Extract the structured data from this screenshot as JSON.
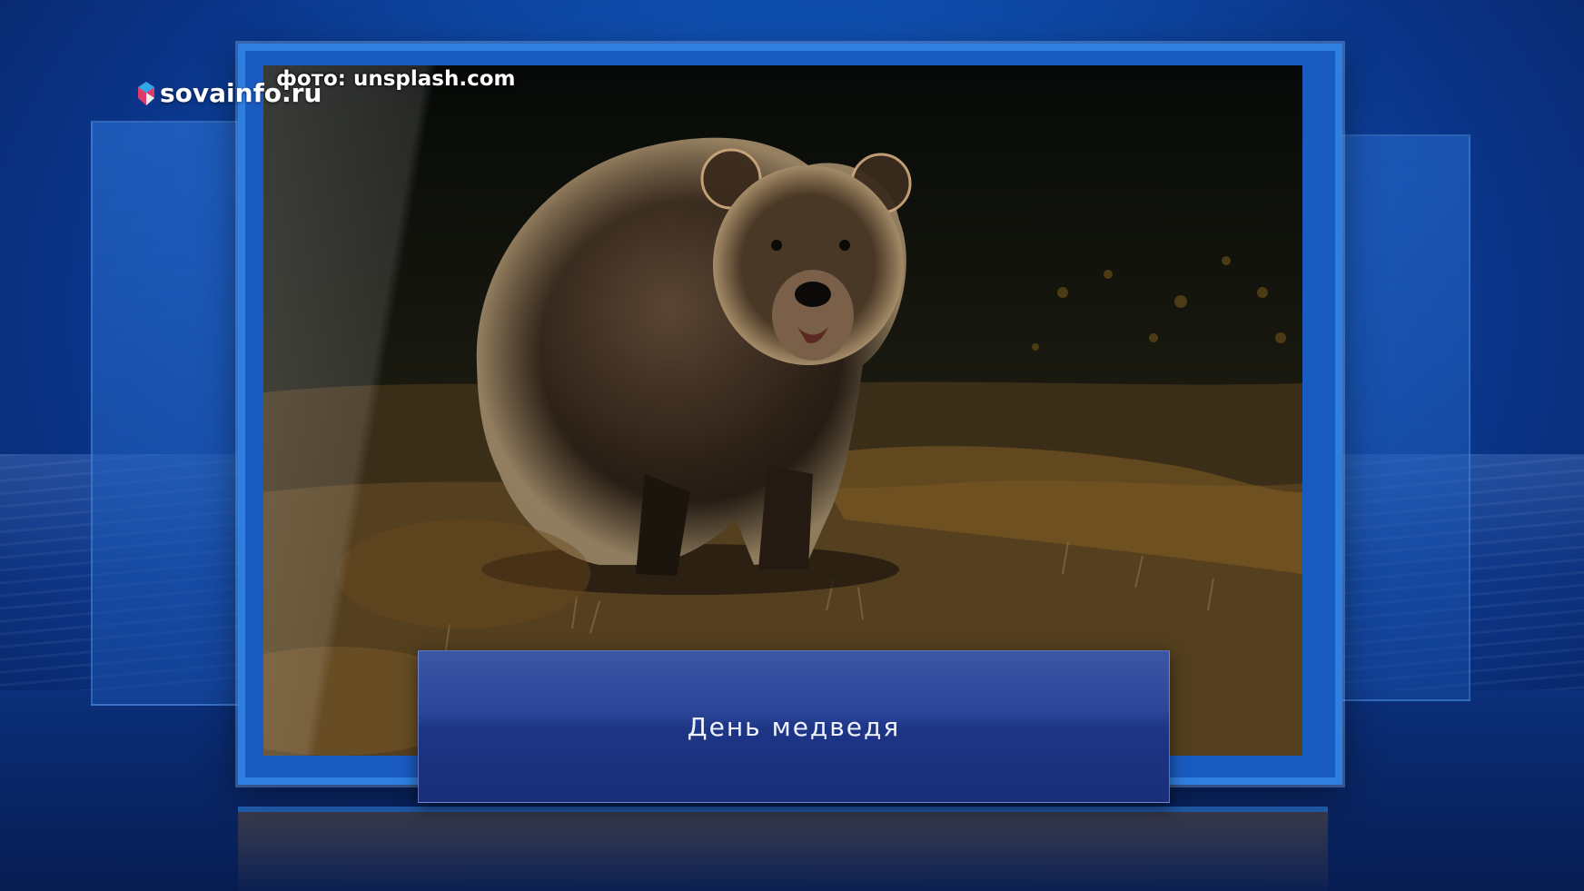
{
  "logo": {
    "text": "sovainfo.ru",
    "icon": "sova-logo-icon"
  },
  "photo": {
    "credit": "фото: unsplash.com",
    "subject": "bear-photo",
    "caption": "День медведя"
  },
  "colors": {
    "frame": "#2f7fe0",
    "background": "#0f4fb0",
    "caption_bar": "#2c4597",
    "text": "#ffffff"
  }
}
